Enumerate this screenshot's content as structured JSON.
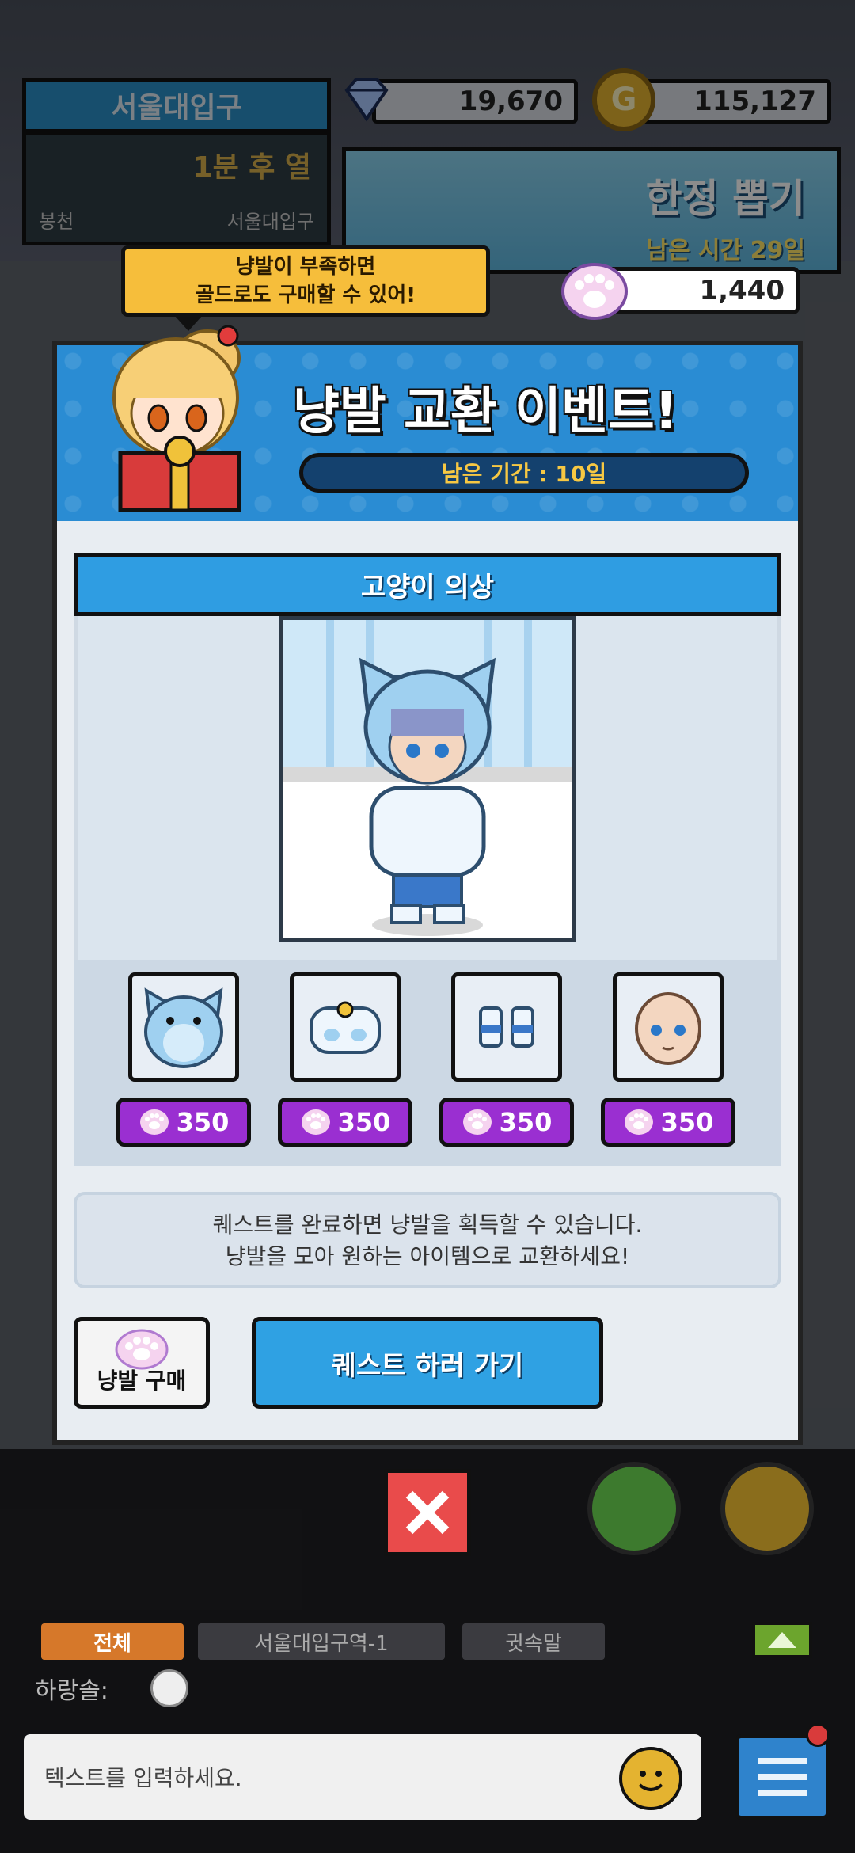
{
  "hud": {
    "station": "서울대입구",
    "timer": "1분 후 열",
    "route_from": "봉천",
    "route_to": "서울대입구",
    "gems": "19,670",
    "gold": "115,127",
    "gold_symbol": "G"
  },
  "gacha": {
    "title": "한정 뽑기",
    "remaining": "남은 시간 29일"
  },
  "paw_balance": "1,440",
  "tooltip": {
    "line1": "냥발이 부족하면",
    "line2": "골드로도 구매할 수 있어!"
  },
  "dialog": {
    "title": "냥발 교환 이벤트!",
    "period": "남은 기간 : 10일",
    "section_title": "고양이 의상",
    "items": [
      {
        "name": "cat-hood",
        "price": "350"
      },
      {
        "name": "cat-top",
        "price": "350"
      },
      {
        "name": "cat-shoes",
        "price": "350"
      },
      {
        "name": "cat-face",
        "price": "350"
      }
    ],
    "info_line1": "퀘스트를 완료하면 냥발을 획득할 수 있습니다.",
    "info_line2": "냥발을 모아 원하는 아이템으로 교환하세요!",
    "buy_label": "냥발 구매",
    "quest_label": "퀘스트 하러 가기"
  },
  "chat": {
    "tab_all": "전체",
    "tab_station": "서울대입구역-1",
    "tab_whisper": "귓속말",
    "speaker": "하랑솔:",
    "placeholder": "텍스트를 입력하세요."
  },
  "colors": {
    "accent_blue": "#2f9de2",
    "price_purple": "#9a2fd1",
    "close_red": "#e94b4b",
    "tooltip_yellow": "#f6be3b"
  }
}
